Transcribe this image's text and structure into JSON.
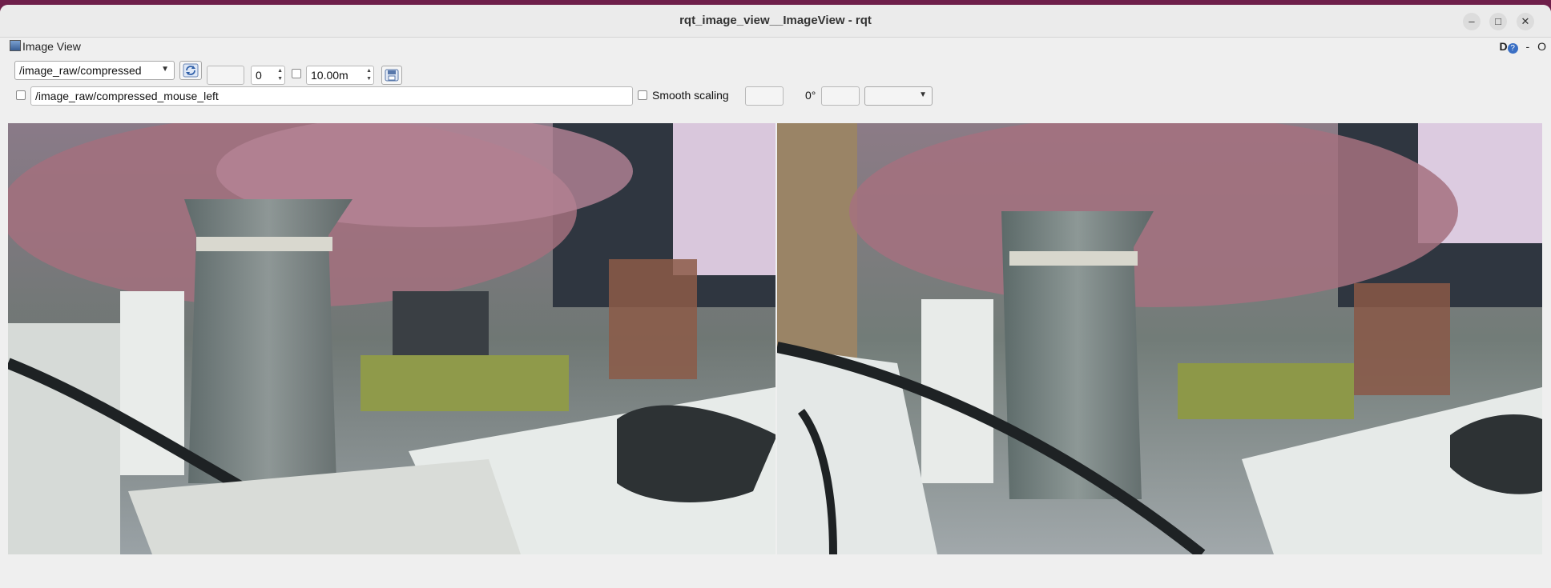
{
  "window": {
    "title": "rqt_image_view__ImageView - rqt"
  },
  "dock": {
    "title": "Image View",
    "d_label": "D",
    "help_label": "?",
    "minus_label": "-",
    "o_label": "O"
  },
  "toolbar": {
    "topic": "/image_raw/compressed",
    "spin_value": "0",
    "duration_value": "10.00m",
    "mouse_topic": "/image_raw/compressed_mouse_left",
    "smooth_scaling_label": "Smooth scaling",
    "rotation_label": "0°"
  },
  "icons": {
    "refresh": "refresh-icon",
    "save": "save-icon",
    "app": "image-view-icon"
  }
}
